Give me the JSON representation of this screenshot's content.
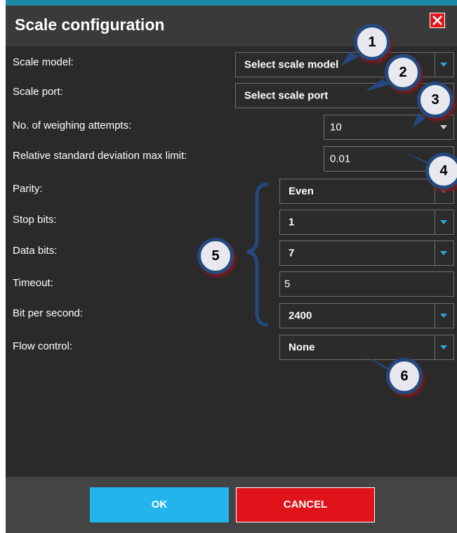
{
  "dialog": {
    "title": "Scale configuration"
  },
  "fields": {
    "scale_model": {
      "label": "Scale model:",
      "value": "Select scale model"
    },
    "scale_port": {
      "label": "Scale port:",
      "value": "Select scale port"
    },
    "weighing_attempts": {
      "label": "No. of weighing attempts:",
      "value": "10"
    },
    "rsd_limit": {
      "label": "Relative standard deviation max limit:",
      "value": "0.01"
    },
    "parity": {
      "label": "Parity:",
      "value": "Even"
    },
    "stop_bits": {
      "label": "Stop bits:",
      "value": "1"
    },
    "data_bits": {
      "label": "Data bits:",
      "value": "7"
    },
    "timeout": {
      "label": "Timeout:",
      "value": "5"
    },
    "bit_per_second": {
      "label": "Bit per second:",
      "value": "2400"
    },
    "flow_control": {
      "label": "Flow control:",
      "value": "None"
    }
  },
  "buttons": {
    "ok": "OK",
    "cancel": "CANCEL"
  },
  "callouts": [
    "1",
    "2",
    "3",
    "4",
    "5",
    "6"
  ],
  "colors": {
    "ok_button": "#23b4ec",
    "cancel_button": "#e0131b",
    "close_button": "#e0161c",
    "dropdown_arrow": "#2aa8e0",
    "callout_border": "#24497e"
  },
  "icons": {
    "close": "close-icon",
    "dropdown": "dropdown-arrow-icon"
  }
}
